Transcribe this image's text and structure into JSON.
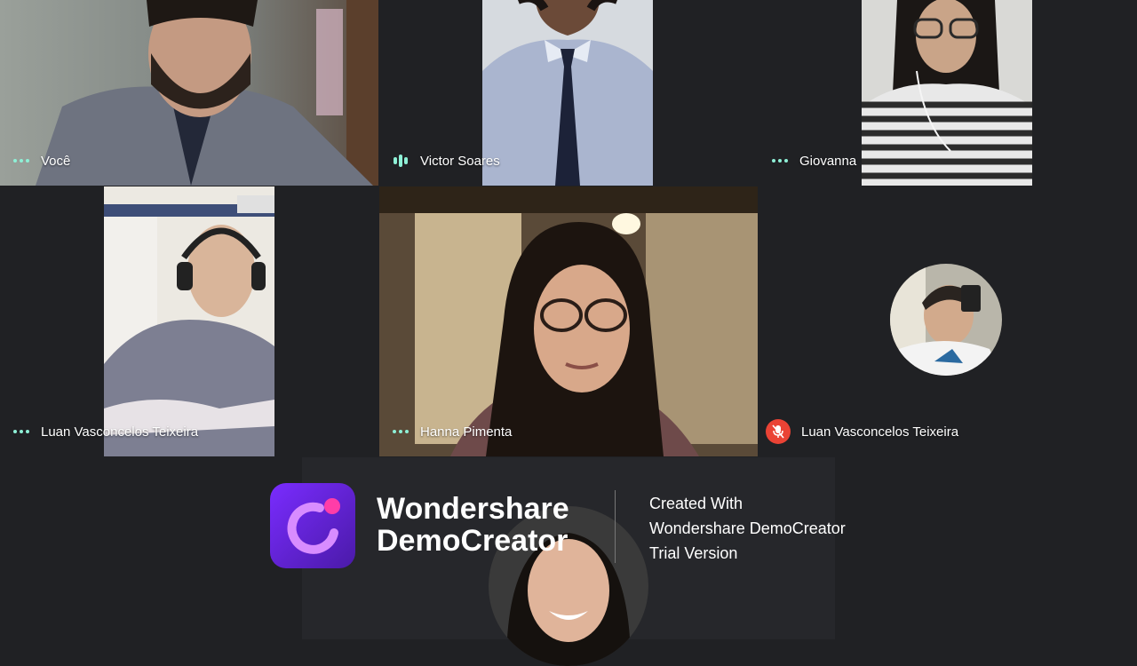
{
  "participants": [
    {
      "name": "Você",
      "status": "dots"
    },
    {
      "name": "Victor Soares",
      "status": "speaking"
    },
    {
      "name": "Giovanna",
      "status": "dots"
    },
    {
      "name": "Luan Vasconcelos Teixeira",
      "status": "dots"
    },
    {
      "name": "Hanna Pimenta",
      "status": "dots"
    },
    {
      "name": "Luan Vasconcelos Teixeira",
      "status": "muted"
    }
  ],
  "watermark": {
    "brand_line1": "Wondershare",
    "brand_line2": "DemoCreator",
    "note_line1": "Created With",
    "note_line2": "Wondershare DemoCreator",
    "note_line3": "Trial Version"
  },
  "colors": {
    "background": "#202124",
    "audio_indicator": "#8ef0d6",
    "muted_badge": "#ea4335",
    "logo_accent": "#ff3da8"
  },
  "icons": [
    "audio-dots-icon",
    "audio-level-icon",
    "mic-off-icon",
    "democreator-logo-icon"
  ]
}
